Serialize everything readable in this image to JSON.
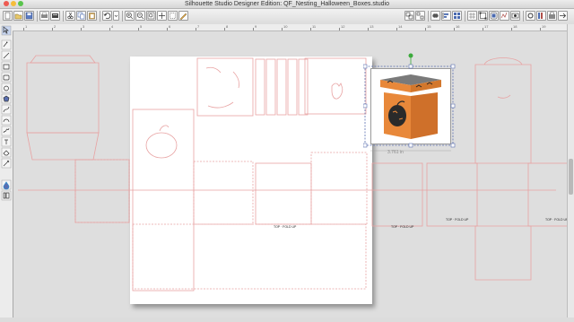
{
  "window": {
    "title": "Silhouette Studio Designer Edition: QF_Nesting_Halloween_Boxes.studio"
  },
  "toolbar": {
    "buttons": [
      "new-document",
      "open",
      "save",
      "print",
      "send-to-silhouette",
      "cut",
      "copy",
      "paste",
      "undo",
      "zoom-in",
      "zoom-out",
      "zoom-fit",
      "pan",
      "draw-freehand"
    ],
    "right_buttons": [
      "group",
      "ungroup",
      "weld",
      "align",
      "replicate",
      "grid",
      "transform",
      "offset",
      "trace",
      "pixscan"
    ]
  },
  "ruler": {
    "labels": [
      "1",
      "2",
      "3",
      "4",
      "5",
      "6",
      "7",
      "8",
      "9",
      "10",
      "11",
      "12",
      "13",
      "14",
      "15",
      "16",
      "17",
      "18",
      "19"
    ]
  },
  "sidebar": {
    "tools": [
      "select-tool",
      "edit-points-tool",
      "line-tool",
      "rectangle-tool",
      "rounded-rectangle-tool",
      "ellipse-tool",
      "polygon-tool",
      "curve-tool",
      "arc-tool",
      "freehand-tool",
      "text-tool",
      "eraser-tool",
      "knife-tool",
      "fill-color-tool",
      "library-tool"
    ]
  },
  "selection": {
    "width_label": "3.761 in"
  },
  "box_labels": {
    "tab_text": "TOP · FOLD UP"
  },
  "colors": {
    "cut_line": "#e8a2a2",
    "selection": "#5a6fb0",
    "rotate_handle": "#3caa3c",
    "box_orange": "#e8883a"
  }
}
